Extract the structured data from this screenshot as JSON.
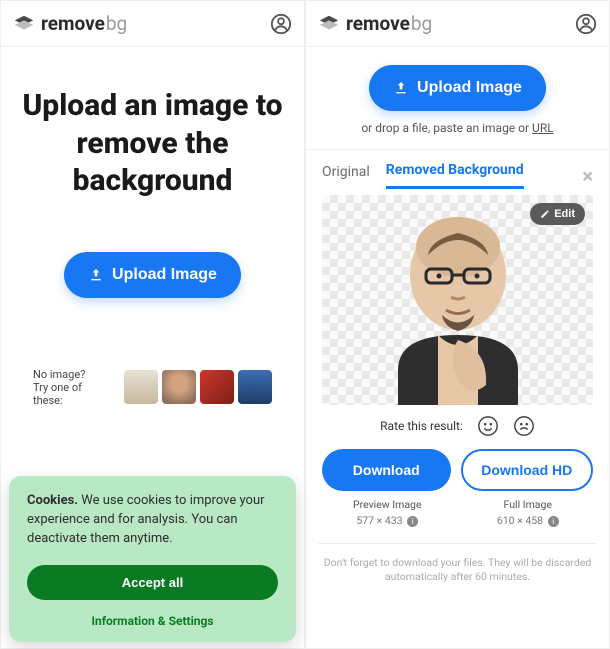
{
  "brand": {
    "remove": "remove",
    "bg": "bg"
  },
  "left": {
    "hero": "Upload an image to remove the background",
    "upload": "Upload Image",
    "noimage_line1": "No image?",
    "noimage_line2": "Try one of these:",
    "cookies": {
      "heading": "Cookies.",
      "body": " We use cookies to improve your experience and for analysis. You can deactivate them anytime.",
      "accept": "Accept all",
      "info": "Information & Settings"
    }
  },
  "right": {
    "upload": "Upload Image",
    "drop_prefix": "or drop a file, paste an image or ",
    "drop_url": "URL",
    "tabs": {
      "original": "Original",
      "removed": "Removed Background"
    },
    "edit": "Edit",
    "rate_label": "Rate this result:",
    "download": "Download",
    "download_hd": "Download HD",
    "preview_label": "Preview Image",
    "preview_dim": "577 × 433",
    "full_label": "Full Image",
    "full_dim": "610 × 458",
    "discard": "Don't forget to download your files. They will be discarded automatically after 60 minutes."
  }
}
